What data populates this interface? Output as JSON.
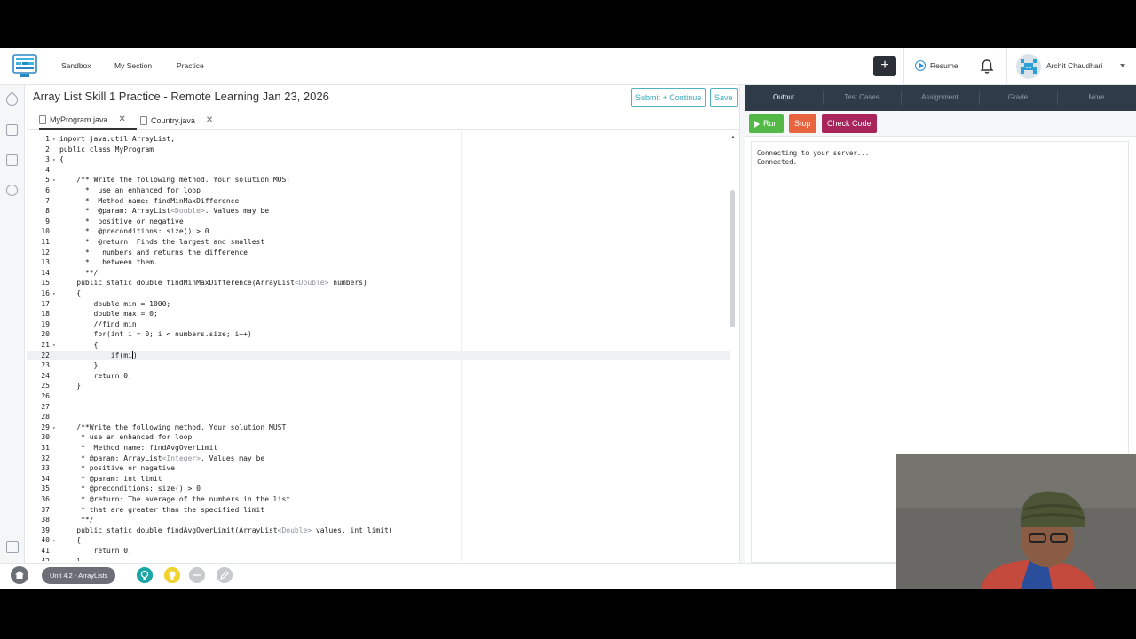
{
  "nav": {
    "links": [
      "Sandbox",
      "My Section",
      "Practice"
    ],
    "plus_label": "+",
    "resume_label": "Resume",
    "user_name": "Archit Chaudhari"
  },
  "editor": {
    "title": "Array List Skill 1 Practice - Remote Learning Jan 23, 2026",
    "submit_label": "Submit + Continue",
    "save_label": "Save",
    "files": [
      {
        "name": "MyProgram.java",
        "active": true
      },
      {
        "name": "Country.java",
        "active": false
      }
    ],
    "current_line": 22,
    "lines": [
      {
        "n": "1",
        "fold": true,
        "text": "import java.util.ArrayList;"
      },
      {
        "n": "2",
        "fold": false,
        "text": "public class MyProgram"
      },
      {
        "n": "3",
        "fold": true,
        "text": "{"
      },
      {
        "n": "4",
        "fold": false,
        "text": ""
      },
      {
        "n": "5",
        "fold": true,
        "text": "    /** Write the following method. Your solution MUST"
      },
      {
        "n": "6",
        "fold": false,
        "text": "      *  use an enhanced for loop"
      },
      {
        "n": "7",
        "fold": false,
        "text": "      *  Method name: findMinMaxDifference"
      },
      {
        "n": "8",
        "fold": false,
        "text": "      *  @param: ArrayList<Double>. Values may be"
      },
      {
        "n": "9",
        "fold": false,
        "text": "      *  positive or negative"
      },
      {
        "n": "10",
        "fold": false,
        "text": "      *  @preconditions: size() > 0"
      },
      {
        "n": "11",
        "fold": false,
        "text": "      *  @return: Finds the largest and smallest"
      },
      {
        "n": "12",
        "fold": false,
        "text": "      *   numbers and returns the difference"
      },
      {
        "n": "13",
        "fold": false,
        "text": "      *   between them."
      },
      {
        "n": "14",
        "fold": false,
        "text": "      **/"
      },
      {
        "n": "15",
        "fold": false,
        "text": "    public static double findMinMaxDifference(ArrayList<Double> numbers)"
      },
      {
        "n": "16",
        "fold": true,
        "text": "    {"
      },
      {
        "n": "17",
        "fold": false,
        "text": "        double min = 1000;"
      },
      {
        "n": "18",
        "fold": false,
        "text": "        double max = 0;"
      },
      {
        "n": "19",
        "fold": false,
        "text": "        //find min"
      },
      {
        "n": "20",
        "fold": false,
        "text": "        for(int i = 0; i < numbers.size; i++)"
      },
      {
        "n": "21",
        "fold": true,
        "text": "        {"
      },
      {
        "n": "22",
        "fold": false,
        "text": "            if(mi)"
      },
      {
        "n": "23",
        "fold": false,
        "text": "        }"
      },
      {
        "n": "24",
        "fold": false,
        "text": "        return 0;"
      },
      {
        "n": "25",
        "fold": false,
        "text": "    }"
      },
      {
        "n": "26",
        "fold": false,
        "text": ""
      },
      {
        "n": "27",
        "fold": false,
        "text": ""
      },
      {
        "n": "28",
        "fold": false,
        "text": ""
      },
      {
        "n": "29",
        "fold": true,
        "text": "    /**Write the following method. Your solution MUST"
      },
      {
        "n": "30",
        "fold": false,
        "text": "     * use an enhanced for loop"
      },
      {
        "n": "31",
        "fold": false,
        "text": "     *  Method name: findAvgOverLimit"
      },
      {
        "n": "32",
        "fold": false,
        "text": "     * @param: ArrayList<Integer>. Values may be"
      },
      {
        "n": "33",
        "fold": false,
        "text": "     * positive or negative"
      },
      {
        "n": "34",
        "fold": false,
        "text": "     * @param: int limit"
      },
      {
        "n": "35",
        "fold": false,
        "text": "     * @preconditions: size() > 0"
      },
      {
        "n": "36",
        "fold": false,
        "text": "     * @return: The average of the numbers in the list"
      },
      {
        "n": "37",
        "fold": false,
        "text": "     * that are greater than the specified limit"
      },
      {
        "n": "38",
        "fold": false,
        "text": "     **/"
      },
      {
        "n": "39",
        "fold": false,
        "text": "    public static double findAvgOverLimit(ArrayList<Double> values, int limit)"
      },
      {
        "n": "40",
        "fold": true,
        "text": "    {"
      },
      {
        "n": "41",
        "fold": false,
        "text": "        return 0;"
      },
      {
        "n": "42",
        "fold": false,
        "text": "    }"
      }
    ]
  },
  "panel": {
    "tabs": [
      "Output",
      "Test Cases",
      "Assignment",
      "Grade",
      "More"
    ],
    "active_tab": "Output",
    "run_label": "Run",
    "stop_label": "Stop",
    "check_label": "Check Code",
    "console": [
      "Connecting to your server...",
      "Connected."
    ]
  },
  "bottom": {
    "unit_label": "Unit 4.2 - ArrayLists"
  },
  "colors": {
    "run": "#52b947",
    "stop": "#e7643f",
    "check": "#a8245b",
    "panel_tabs_bg": "#2f3b49",
    "accent": "#3aa6b9"
  }
}
